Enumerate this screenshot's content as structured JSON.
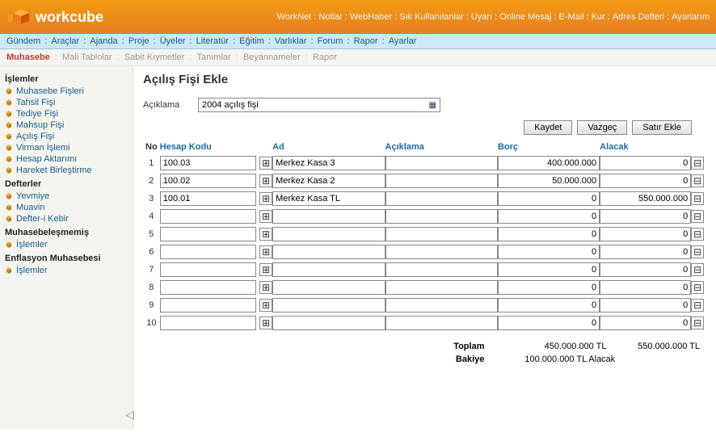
{
  "brand": "workcube",
  "header_links": [
    "WorkNet",
    "Notlar",
    "WebHaber",
    "Sık Kullanılanlar",
    "Uyarı",
    "Online Mesaj",
    "E-Mail",
    "Kur",
    "Adres Defteri",
    "Ayarlarım"
  ],
  "menubar": [
    "Gündem",
    "Araçlar",
    "Ajanda",
    "Proje",
    "Üyeler",
    "Literatür",
    "Eğitim",
    "Varlıklar",
    "Forum",
    "Rapor",
    "Ayarlar"
  ],
  "submenu": {
    "active": "Muhasebe",
    "items": [
      "Mali Tablolar",
      "Sabit Kıymetler",
      "Tanımlar",
      "Beyannameler",
      "Rapor"
    ]
  },
  "sidebar": {
    "groups": [
      {
        "title": "İşlemler",
        "items": [
          "Muhasebe Fişleri",
          "Tahsil Fişi",
          "Tediye Fişi",
          "Mahsup Fişi",
          "Açılış Fişi",
          "Virman İşlemi",
          "Hesap Aktarımı",
          "Hareket Birleştirme"
        ]
      },
      {
        "title": "Defterler",
        "items": [
          "Yevmiye",
          "Muavin",
          "Defter-i Kebir"
        ]
      },
      {
        "title": "Muhasebeleşmemiş",
        "items": [
          "İşlemler"
        ]
      },
      {
        "title": "Enflasyon Muhasebesi",
        "items": [
          "İşlemler"
        ]
      }
    ]
  },
  "page": {
    "title": "Açılış Fişi Ekle",
    "desc_label": "Açıklama",
    "desc_value": "2004 açılış fişi",
    "buttons": {
      "save": "Kaydet",
      "cancel": "Vazgeç",
      "addrow": "Satır Ekle"
    },
    "columns": {
      "no": "No",
      "hesap": "Hesap Kodu",
      "ad": "Ad",
      "acik": "Açıklama",
      "borc": "Borç",
      "alacak": "Alacak"
    },
    "rows": [
      {
        "no": "1",
        "hesap": "100.03",
        "ad": "Merkez Kasa 3",
        "acik": "",
        "borc": "400.000.000",
        "alacak": "0"
      },
      {
        "no": "2",
        "hesap": "100.02",
        "ad": "Merkez Kasa 2",
        "acik": "",
        "borc": "50.000.000",
        "alacak": "0"
      },
      {
        "no": "3",
        "hesap": "100.01",
        "ad": "Merkez Kasa TL",
        "acik": "",
        "borc": "0",
        "alacak": "550.000.000"
      },
      {
        "no": "4",
        "hesap": "",
        "ad": "",
        "acik": "",
        "borc": "0",
        "alacak": "0"
      },
      {
        "no": "5",
        "hesap": "",
        "ad": "",
        "acik": "",
        "borc": "0",
        "alacak": "0"
      },
      {
        "no": "6",
        "hesap": "",
        "ad": "",
        "acik": "",
        "borc": "0",
        "alacak": "0"
      },
      {
        "no": "7",
        "hesap": "",
        "ad": "",
        "acik": "",
        "borc": "0",
        "alacak": "0"
      },
      {
        "no": "8",
        "hesap": "",
        "ad": "",
        "acik": "",
        "borc": "0",
        "alacak": "0"
      },
      {
        "no": "9",
        "hesap": "",
        "ad": "",
        "acik": "",
        "borc": "0",
        "alacak": "0"
      },
      {
        "no": "10",
        "hesap": "",
        "ad": "",
        "acik": "",
        "borc": "0",
        "alacak": "0"
      }
    ],
    "totals": {
      "toplam_label": "Toplam",
      "toplam_borc": "450.000.000 TL",
      "toplam_alacak": "550.000.000 TL",
      "bakiye_label": "Bakiye",
      "bakiye_value": "100.000.000 TL Alacak"
    }
  }
}
